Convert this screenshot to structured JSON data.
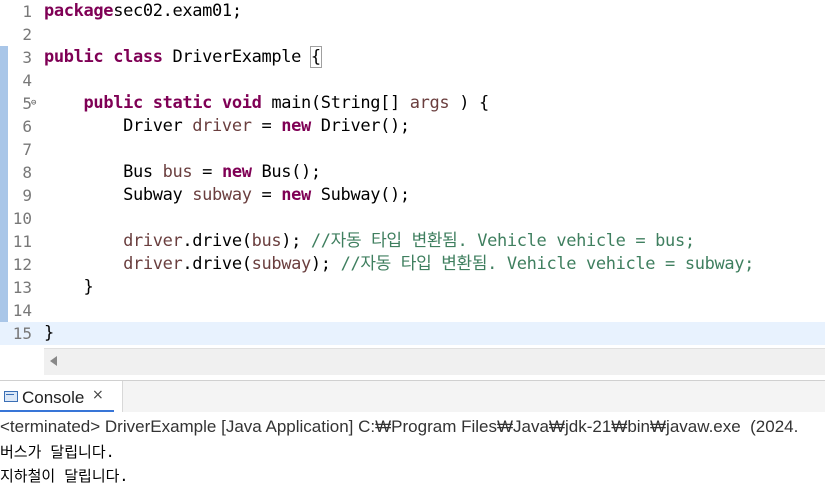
{
  "editor": {
    "file": "DriverExample.java",
    "lines": [
      {
        "n": "1",
        "tokens": [
          [
            "kw",
            "package"
          ],
          [
            "",
            "sec02.exam01;"
          ]
        ]
      },
      {
        "n": "2",
        "tokens": []
      },
      {
        "n": "3",
        "tokens": [
          [
            "kw",
            "public"
          ],
          [
            "",
            " "
          ],
          [
            "kw",
            "class"
          ],
          [
            "",
            " DriverExample "
          ],
          [
            "brk",
            "{"
          ]
        ]
      },
      {
        "n": "4",
        "tokens": []
      },
      {
        "n": "5",
        "tokens": [
          [
            "",
            "    "
          ],
          [
            "kw",
            "public"
          ],
          [
            "",
            " "
          ],
          [
            "kw",
            "static"
          ],
          [
            "",
            " "
          ],
          [
            "kw",
            "void"
          ],
          [
            "",
            " main(String[] "
          ],
          [
            "var",
            "args"
          ],
          [
            "",
            " ) {"
          ]
        ]
      },
      {
        "n": "6",
        "tokens": [
          [
            "",
            "        Driver "
          ],
          [
            "var",
            "driver"
          ],
          [
            "",
            " = "
          ],
          [
            "kw",
            "new"
          ],
          [
            "",
            " Driver();"
          ]
        ]
      },
      {
        "n": "7",
        "tokens": []
      },
      {
        "n": "8",
        "tokens": [
          [
            "",
            "        Bus "
          ],
          [
            "var",
            "bus"
          ],
          [
            "",
            " = "
          ],
          [
            "kw",
            "new"
          ],
          [
            "",
            " Bus();"
          ]
        ]
      },
      {
        "n": "9",
        "tokens": [
          [
            "",
            "        Subway "
          ],
          [
            "var",
            "subway"
          ],
          [
            "",
            " = "
          ],
          [
            "kw",
            "new"
          ],
          [
            "",
            " Subway();"
          ]
        ]
      },
      {
        "n": "10",
        "tokens": []
      },
      {
        "n": "11",
        "tokens": [
          [
            "var",
            "        driver"
          ],
          [
            "",
            ".drive("
          ],
          [
            "var",
            "bus"
          ],
          [
            "",
            "); "
          ],
          [
            "cm",
            "//자동 타입 변환됨. Vehicle vehicle = bus;"
          ]
        ]
      },
      {
        "n": "12",
        "tokens": [
          [
            "var",
            "        driver"
          ],
          [
            "",
            ".drive("
          ],
          [
            "var",
            "subway"
          ],
          [
            "",
            "); "
          ],
          [
            "cm",
            "//자동 타입 변환됨. Vehicle vehicle = subway;"
          ]
        ]
      },
      {
        "n": "13",
        "tokens": [
          [
            "",
            "    }"
          ]
        ]
      },
      {
        "n": "14",
        "tokens": []
      },
      {
        "n": "15",
        "tokens": [
          [
            "",
            "}"
          ]
        ]
      }
    ],
    "current_line": "15",
    "fold_marker_line": "5",
    "fold_marker": "⊖"
  },
  "console": {
    "tab_label": "Console",
    "close_glyph": "×",
    "process_line": "<terminated> DriverExample [Java Application] C:₩Program Files₩Java₩jdk-21₩bin₩javaw.exe  (2024.",
    "output": [
      "버스가 달립니다.",
      "지하철이 달립니다."
    ]
  },
  "colors": {
    "keyword": "#7f0055",
    "variable": "#6a3e3e",
    "comment": "#3f7f5f",
    "current_line_bg": "#e8f2fe",
    "ruler_blue": "#a9c6e8"
  },
  "icons": {
    "console": "console-icon",
    "close": "close-icon",
    "fold": "fold-collapse-icon",
    "scroll_left": "scroll-left-arrow-icon"
  }
}
